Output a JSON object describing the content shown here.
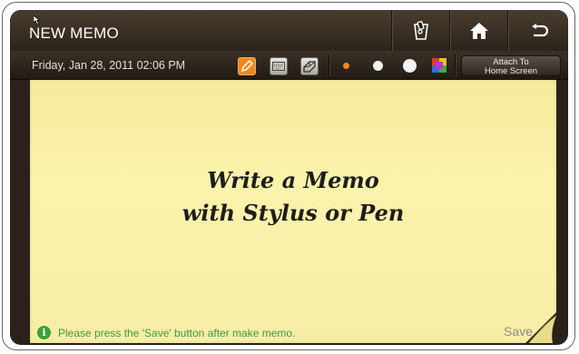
{
  "header": {
    "title": "NEW MEMO",
    "icons": [
      "memo-list-icon",
      "home-icon",
      "back-icon"
    ]
  },
  "toolbar": {
    "datetime": "Friday, Jan 28, 2011 02:06 PM",
    "tools": [
      "pen-icon",
      "keyboard-icon",
      "eraser-icon"
    ],
    "active_tool": "pen-icon",
    "pen_sizes": [
      "small",
      "medium",
      "large"
    ],
    "selected_pen_size": "small",
    "palette_icon": "color-palette-icon",
    "attach_label_line1": "Attach To",
    "attach_label_line2": "Home Screen"
  },
  "memo": {
    "line1": "Write a Memo",
    "line2": "with Stylus or Pen"
  },
  "footer": {
    "info_text": "Please press the 'Save' button after make memo.",
    "save_label": "Save"
  },
  "colors": {
    "accent": "#ef8a1e",
    "note": "#fbf2ac",
    "info": "#3c9a40"
  }
}
